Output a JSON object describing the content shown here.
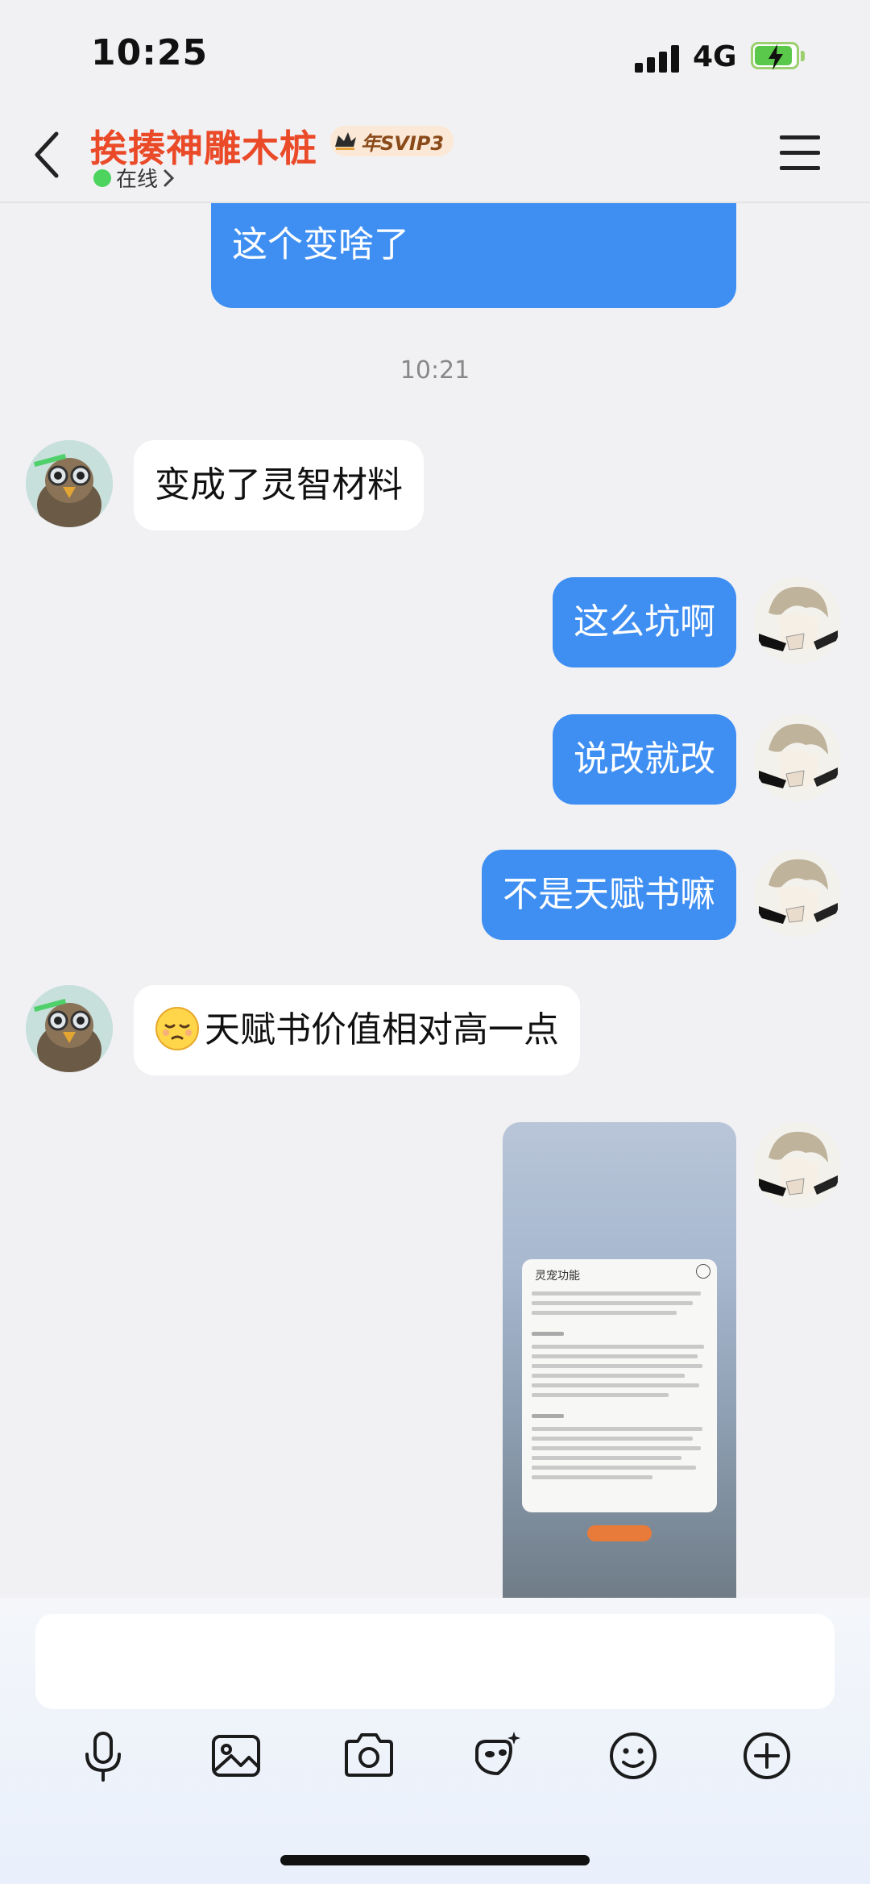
{
  "status": {
    "time": "10:25",
    "network": "4G"
  },
  "header": {
    "name": "挨揍神雕木桩",
    "vip_badge": "年SVIP3",
    "presence": "在线"
  },
  "messages": [
    {
      "side": "out",
      "text": "这个变啥了"
    },
    {
      "type": "timestamp",
      "text": "10:21"
    },
    {
      "side": "in",
      "text": "变成了灵智材料"
    },
    {
      "side": "out",
      "text": "这么坑啊"
    },
    {
      "side": "out",
      "text": "说改就改"
    },
    {
      "side": "out",
      "text": "不是天赋书嘛"
    },
    {
      "side": "in",
      "text": "天赋书价值相对高一点",
      "emoji": "pensive-face"
    },
    {
      "side": "out",
      "type": "image",
      "caption": "灵宠功能"
    }
  ],
  "toolbar": [
    "mic-icon",
    "image-icon",
    "camera-icon",
    "fun-icon",
    "emoji-icon",
    "plus-icon"
  ]
}
